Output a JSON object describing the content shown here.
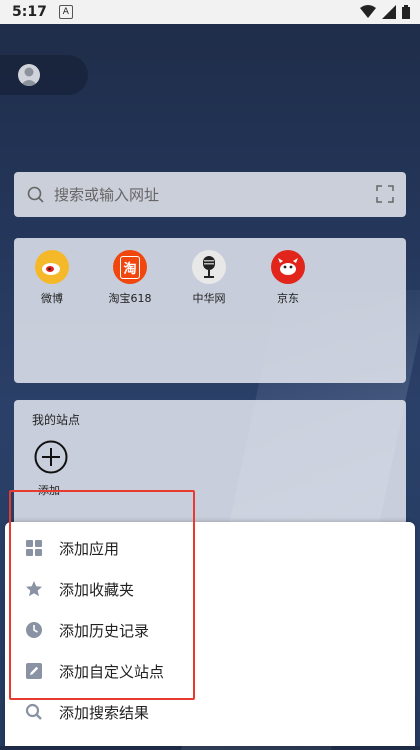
{
  "status_bar": {
    "time": "5:17",
    "notif": "A"
  },
  "search": {
    "placeholder": "搜索或输入网址"
  },
  "quick_sites": [
    {
      "label": "微博",
      "icon": "weibo-icon",
      "color": "#f5b829"
    },
    {
      "label": "淘宝618",
      "icon": "taobao-icon",
      "color": "#f0470f",
      "glyph": "淘"
    },
    {
      "label": "中华网",
      "icon": "china-com-icon",
      "color": "#e8e8e8"
    },
    {
      "label": "京东",
      "icon": "jd-icon",
      "color": "#e1251b"
    }
  ],
  "my_sites": {
    "title": "我的站点",
    "add_label": "添加"
  },
  "menu": {
    "items": [
      {
        "label": "添加应用",
        "icon": "grid-icon"
      },
      {
        "label": "添加收藏夹",
        "icon": "star-icon"
      },
      {
        "label": "添加历史记录",
        "icon": "clock-icon"
      },
      {
        "label": "添加自定义站点",
        "icon": "edit-icon"
      },
      {
        "label": "添加搜索结果",
        "icon": "search-icon"
      }
    ]
  },
  "colors": {
    "highlight": "#e83a2f",
    "icon_gray": "#8a93a3"
  }
}
